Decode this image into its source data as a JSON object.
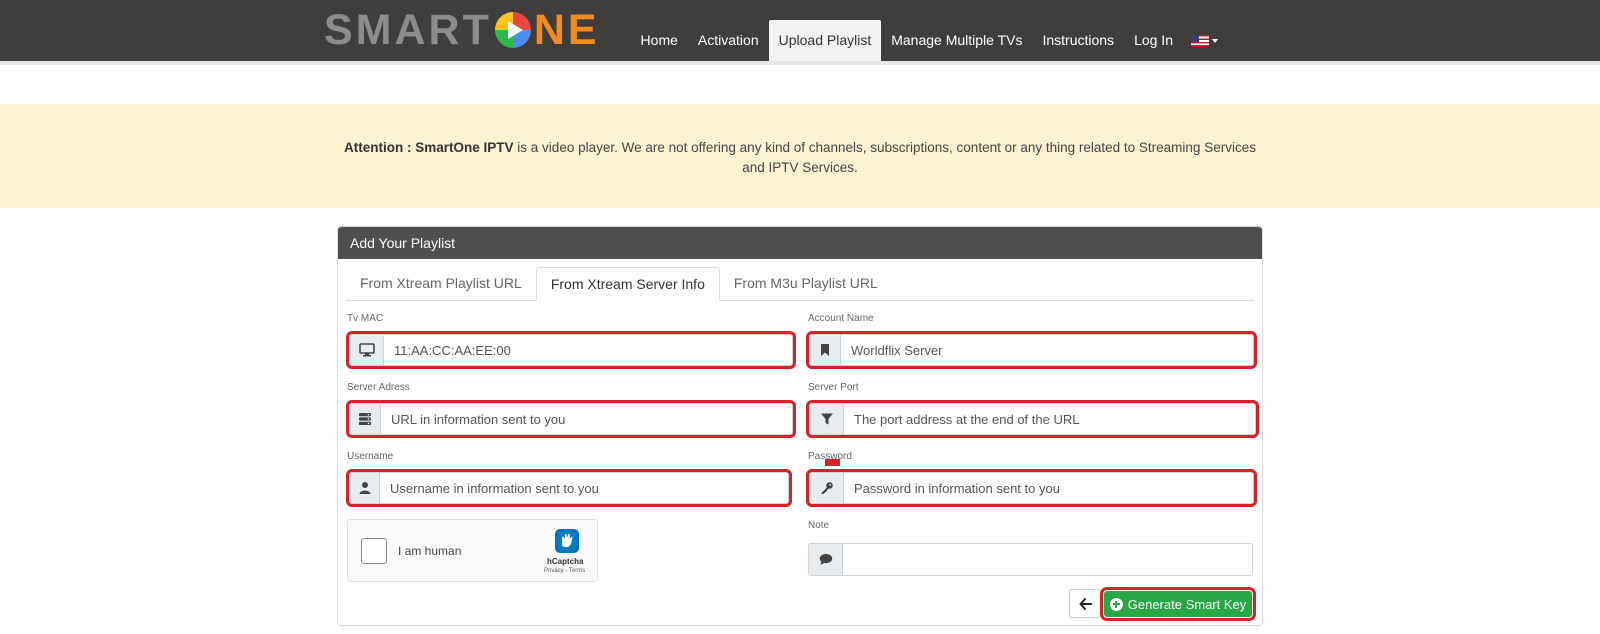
{
  "brand": {
    "logo_left": "SMART",
    "logo_right": "NE"
  },
  "nav": {
    "items": [
      {
        "label": "Home"
      },
      {
        "label": "Activation"
      },
      {
        "label": "Upload Playlist",
        "active": true
      },
      {
        "label": "Manage Multiple TVs"
      },
      {
        "label": "Instructions"
      },
      {
        "label": "Log In"
      }
    ],
    "language_flag": "us-flag-icon"
  },
  "banner": {
    "strong": "Attention : SmartOne IPTV",
    "text": " is a video player. We are not offering any kind of channels, subscriptions, content or any thing related to Streaming Services and IPTV Services."
  },
  "panel": {
    "title": "Add Your Playlist",
    "tabs": [
      {
        "label": "From Xtream Playlist URL"
      },
      {
        "label": "From Xtream Server Info",
        "active": true
      },
      {
        "label": "From M3u Playlist URL"
      }
    ]
  },
  "form": {
    "tv_mac": {
      "label": "Tv MAC",
      "value": "11:AA:CC:AA:EE:00",
      "icon": "monitor-icon"
    },
    "account_name": {
      "label": "Account Name",
      "value": "Worldflix Server",
      "icon": "bookmark-icon"
    },
    "server_address": {
      "label": "Server Adress",
      "value": "URL in information sent to you",
      "icon": "server-icon"
    },
    "server_port": {
      "label": "Server Port",
      "value": "The port address at the end of the URL",
      "icon": "filter-icon"
    },
    "username": {
      "label": "Username",
      "value": "Username in information sent to you",
      "icon": "user-icon"
    },
    "password": {
      "label": "Password",
      "value": "Password in information sent to you",
      "icon": "key-icon"
    },
    "note": {
      "label": "Note",
      "value": "",
      "icon": "comment-icon"
    }
  },
  "captcha": {
    "label": "I am human",
    "brand": "hCaptcha",
    "links": "Privacy - Terms"
  },
  "actions": {
    "back_icon": "arrow-left-icon",
    "generate": "Generate Smart Key"
  },
  "colors": {
    "navbar": "#403e3c",
    "banner": "#fdf3d1",
    "accent_orange": "#f28b20",
    "success": "#28a745",
    "highlight_red": "#d72027"
  }
}
